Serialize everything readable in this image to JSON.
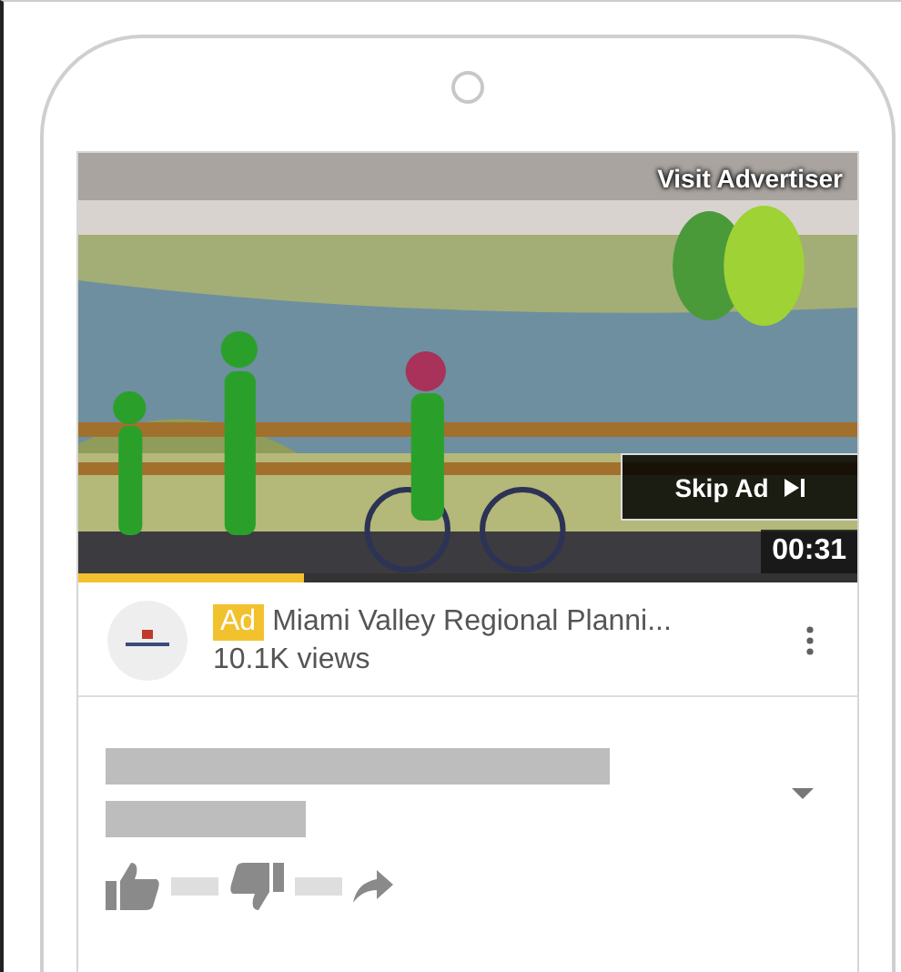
{
  "video": {
    "visit_label": "Visit Advertiser",
    "skip_label": "Skip Ad",
    "duration": "00:31",
    "level": 0.29
  },
  "ad": {
    "badge": "Ad",
    "title": "Miami Valley Regional Planni...",
    "views": "10.1K views"
  }
}
